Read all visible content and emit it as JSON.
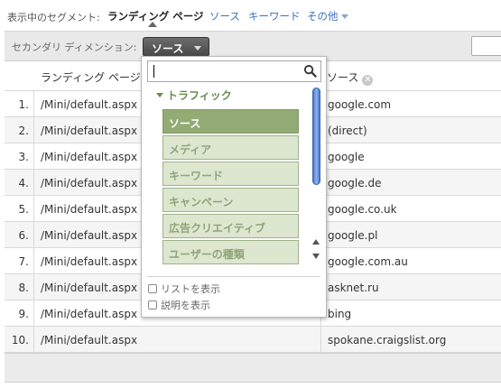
{
  "segment_bar": {
    "prefix": "表示中のセグメント:",
    "active": "ランディング ページ",
    "links": [
      "ソース",
      "キーワード",
      "その他"
    ]
  },
  "toolbar": {
    "label": "セカンダリ ディメンション:",
    "dimension_button": "ソース",
    "search_value": ""
  },
  "table": {
    "headers": {
      "landing_page": "ランディング ページ",
      "source": "ソース"
    },
    "rows": [
      {
        "num": "1.",
        "page": "/Mini/default.aspx",
        "source": "google.com"
      },
      {
        "num": "2.",
        "page": "/Mini/default.aspx",
        "source": "(direct)"
      },
      {
        "num": "3.",
        "page": "/Mini/default.aspx",
        "source": "google"
      },
      {
        "num": "4.",
        "page": "/Mini/default.aspx",
        "source": "google.de"
      },
      {
        "num": "5.",
        "page": "/Mini/default.aspx",
        "source": "google.co.uk"
      },
      {
        "num": "6.",
        "page": "/Mini/default.aspx",
        "source": "google.pl"
      },
      {
        "num": "7.",
        "page": "/Mini/default.aspx",
        "source": "google.com.au"
      },
      {
        "num": "8.",
        "page": "/Mini/default.aspx",
        "source": "asknet.ru"
      },
      {
        "num": "9.",
        "page": "/Mini/default.aspx",
        "source": "bing"
      },
      {
        "num": "10.",
        "page": "/Mini/default.aspx",
        "source": "spokane.craigslist.org"
      }
    ]
  },
  "dropdown": {
    "search_value": "",
    "group_label": "トラフィック",
    "items": [
      "ソース",
      "メディア",
      "キーワード",
      "キャンペーン",
      "広告クリエイティブ",
      "ユーザーの種類"
    ],
    "selected_index": 0,
    "options": {
      "show_list": "リストを表示",
      "show_description": "説明を表示"
    }
  },
  "colors": {
    "link": "#3a6fc4",
    "item_bg": "#dde6cf",
    "item_selected_bg": "#93ab74",
    "group_text": "#6b8a4e",
    "scroll_thumb": "#4a78c9"
  }
}
